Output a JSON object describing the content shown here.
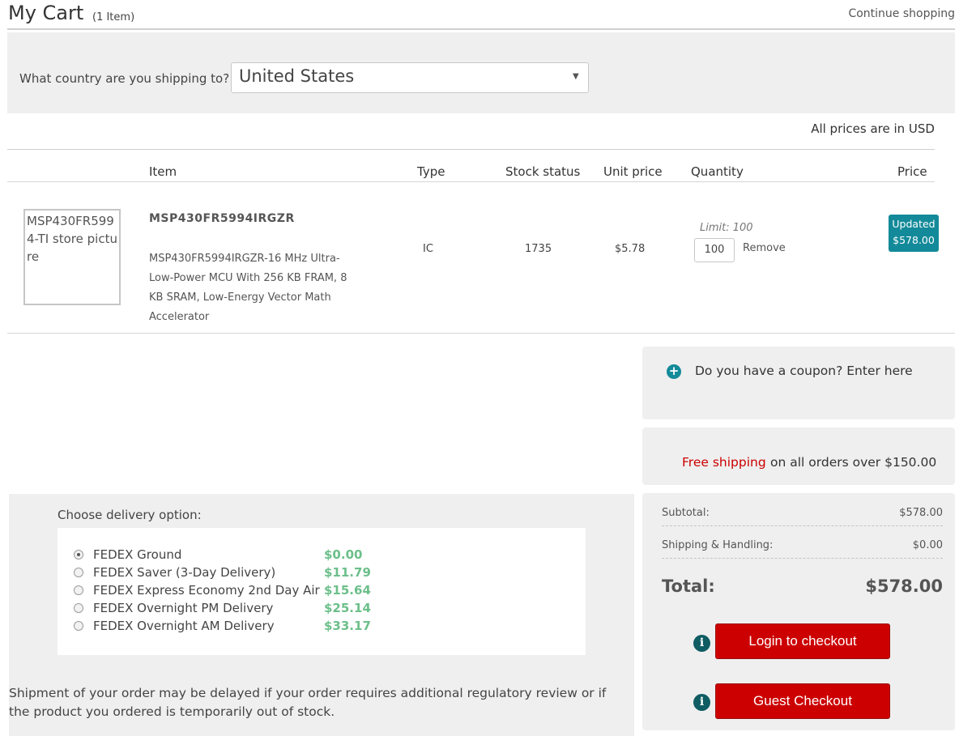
{
  "header": {
    "title": "My Cart",
    "item_count": "(1  Item)",
    "continue_label": "Continue shopping"
  },
  "shipping_country": {
    "label": "What country are you shipping to?",
    "selected": "United States"
  },
  "prices_note": "All prices are in USD",
  "table": {
    "headers": {
      "item": "Item",
      "type": "Type",
      "stock": "Stock status",
      "unit_price": "Unit price",
      "quantity": "Quantity",
      "price": "Price"
    },
    "row": {
      "image_alt": "MSP430FR5994-TI store picture",
      "name": "MSP430FR5994IRGZR",
      "description": "MSP430FR5994IRGZR-16 MHz Ultra-Low-Power MCU With 256 KB FRAM, 8 KB SRAM, Low-Energy Vector Math Accelerator",
      "type": "IC",
      "stock": "1735",
      "unit_price": "$5.78",
      "limit": "Limit: 100",
      "quantity": "100",
      "remove_label": "Remove",
      "badge_line1": "Updated",
      "badge_line2": "$578.00"
    }
  },
  "coupon": {
    "label": "Do you have a coupon? Enter here"
  },
  "shipping_promo": {
    "highlight": "Free shipping",
    "rest": "on all orders over $150.00"
  },
  "summary": {
    "subtotal_label": "Subtotal:",
    "subtotal_value": "$578.00",
    "shipping_label": "Shipping & Handling:",
    "shipping_value": "$0.00",
    "total_label": "Total:",
    "total_value": "$578.00",
    "login_button": "Login to checkout",
    "guest_button": "Guest Checkout"
  },
  "delivery": {
    "title": "Choose delivery option:",
    "options": [
      {
        "label": "FEDEX Ground",
        "price": "$0.00",
        "selected": true
      },
      {
        "label": "FEDEX Saver (3-Day Delivery)",
        "price": "$11.79",
        "selected": false
      },
      {
        "label": "FEDEX Express Economy 2nd Day Air",
        "price": "$15.64",
        "selected": false
      },
      {
        "label": "FEDEX Overnight PM Delivery",
        "price": "$25.14",
        "selected": false
      },
      {
        "label": "FEDEX Overnight AM Delivery",
        "price": "$33.17",
        "selected": false
      }
    ],
    "note": "Shipment of your order may be delayed if your order requires additional regulatory review or if the product you ordered is temporarily out of stock."
  },
  "colors": {
    "accent_teal": "#138a99",
    "button_red": "#cc0000",
    "price_green": "#6cbf8a"
  }
}
